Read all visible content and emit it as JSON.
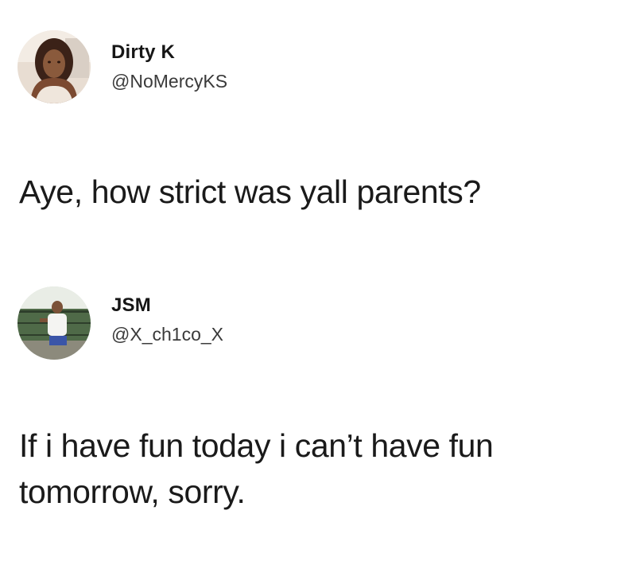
{
  "tweets": [
    {
      "display_name": "Dirty K",
      "handle": "@NoMercyKS",
      "text": "Aye, how strict was yall parents?"
    },
    {
      "display_name": "JSM",
      "handle": "@X_ch1co_X",
      "text": "If i have fun today i can’t have fun tomorrow, sorry."
    }
  ]
}
